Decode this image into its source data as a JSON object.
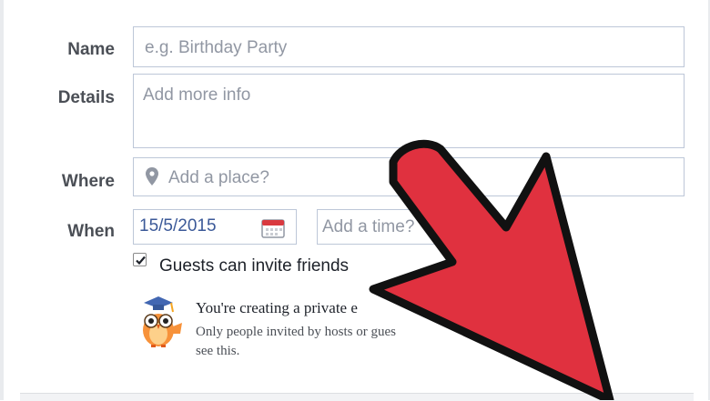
{
  "form": {
    "name_label": "Name",
    "name_placeholder": "e.g. Birthday Party",
    "details_label": "Details",
    "details_placeholder": "Add more info",
    "where_label": "Where",
    "where_placeholder": "Add a place?",
    "when_label": "When",
    "when_date": "15/5/2015",
    "time_placeholder": "Add a time?",
    "guests_checkbox_label": "Guests can invite friends",
    "guests_checked": true
  },
  "privacy_notice": {
    "title": "You're creating a private e",
    "line1": "Only people invited by hosts or gues",
    "line2": "see this."
  },
  "annotation": {
    "arrow_color": "#e0313f",
    "arrow_outline": "#111111"
  }
}
